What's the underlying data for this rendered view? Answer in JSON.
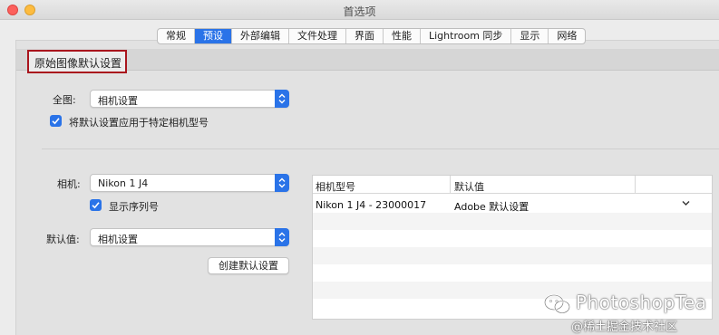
{
  "window": {
    "title": "首选项"
  },
  "tabs": [
    {
      "label": "常规",
      "active": false
    },
    {
      "label": "预设",
      "active": true
    },
    {
      "label": "外部编辑",
      "active": false
    },
    {
      "label": "文件处理",
      "active": false
    },
    {
      "label": "界面",
      "active": false
    },
    {
      "label": "性能",
      "active": false
    },
    {
      "label": "Lightroom 同步",
      "active": false
    },
    {
      "label": "显示",
      "active": false
    },
    {
      "label": "网络",
      "active": false
    }
  ],
  "section": {
    "title": "原始图像默认设置",
    "highlight_color": "#a9151d"
  },
  "global": {
    "label": "全图:",
    "value": "相机设置"
  },
  "apply_camera": {
    "label": "将默认设置应用于特定相机型号",
    "checked": true
  },
  "camera": {
    "label": "相机:",
    "value": "Nikon 1 J4"
  },
  "show_serial": {
    "label": "显示序列号",
    "checked": true
  },
  "default": {
    "label": "默认值:",
    "value": "相机设置"
  },
  "create_button": {
    "label": "创建默认设置"
  },
  "table": {
    "headers": [
      "相机型号",
      "默认值"
    ],
    "rows": [
      {
        "model": "Nikon 1 J4 - 23000017",
        "default": "Adobe 默认设置"
      }
    ]
  },
  "watermark": {
    "line1": "PhotoshopTea",
    "line2": "@稀土掘金技术社区"
  },
  "colors": {
    "accent": "#2a73e8",
    "close": "#fc605c",
    "minimize": "#fdbc40"
  }
}
